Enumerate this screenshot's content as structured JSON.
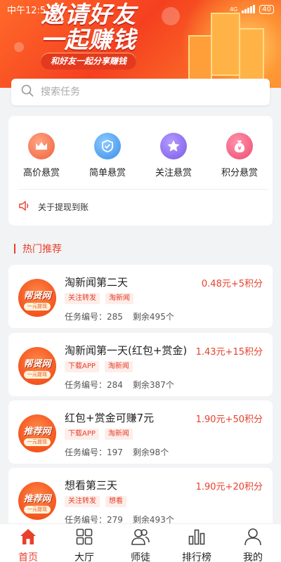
{
  "status_bar": {
    "time": "中午12:5",
    "network": "4G",
    "battery": "40"
  },
  "banner": {
    "title_line1": "邀请好友",
    "title_line2": "一起赚钱",
    "subtitle": "和好友一起分享赚钱"
  },
  "search": {
    "placeholder": "搜索任务"
  },
  "categories": [
    {
      "label": "高价悬赏",
      "icon": "crown-icon",
      "color": "#f47a4f"
    },
    {
      "label": "简单悬赏",
      "icon": "medal-icon",
      "color": "#4aa5ee"
    },
    {
      "label": "关注悬赏",
      "icon": "star-icon",
      "color": "#8b6ef0"
    },
    {
      "label": "积分悬赏",
      "icon": "money-bag-icon",
      "color": "#f6557a"
    }
  ],
  "notice": {
    "text": "关于提现到账"
  },
  "section": {
    "title": "热门推荐"
  },
  "tasks": [
    {
      "title": "淘新闻第二天",
      "reward": "0.48元+5积分",
      "tags": [
        "关注转发",
        "淘新闻"
      ],
      "id_label": "任务编号：",
      "id_value": "285",
      "remaining": "剩余495个",
      "logo_text": "帮贤网",
      "logo_sub": "一元提现"
    },
    {
      "title": "淘新闻第一天(红包+赏金)",
      "reward": "1.43元+15积分",
      "tags": [
        "下载APP",
        "淘新闻"
      ],
      "id_label": "任务编号：",
      "id_value": "284",
      "remaining": "剩余387个",
      "logo_text": "帮贤网",
      "logo_sub": "一元提现"
    },
    {
      "title": "红包+赏金可赚7元",
      "reward": "1.90元+50积分",
      "tags": [
        "下载APP",
        "淘新闻"
      ],
      "id_label": "任务编号：",
      "id_value": "197",
      "remaining": "剩余98个",
      "logo_text": "推荐网",
      "logo_sub": "一元提现"
    },
    {
      "title": "想看第三天",
      "reward": "1.90元+20积分",
      "tags": [
        "关注转发",
        "想看"
      ],
      "id_label": "任务编号：",
      "id_value": "279",
      "remaining": "剩余493个",
      "logo_text": "推荐网",
      "logo_sub": "一元提现"
    }
  ],
  "bottom_nav": [
    {
      "label": "首页",
      "icon": "home-icon",
      "active": true
    },
    {
      "label": "大厅",
      "icon": "grid-icon",
      "active": false
    },
    {
      "label": "师徒",
      "icon": "people-icon",
      "active": false
    },
    {
      "label": "排行榜",
      "icon": "bar-chart-icon",
      "active": false
    },
    {
      "label": "我的",
      "icon": "person-icon",
      "active": false
    }
  ],
  "colors": {
    "accent": "#e8402c",
    "banner": "#f5401f"
  }
}
